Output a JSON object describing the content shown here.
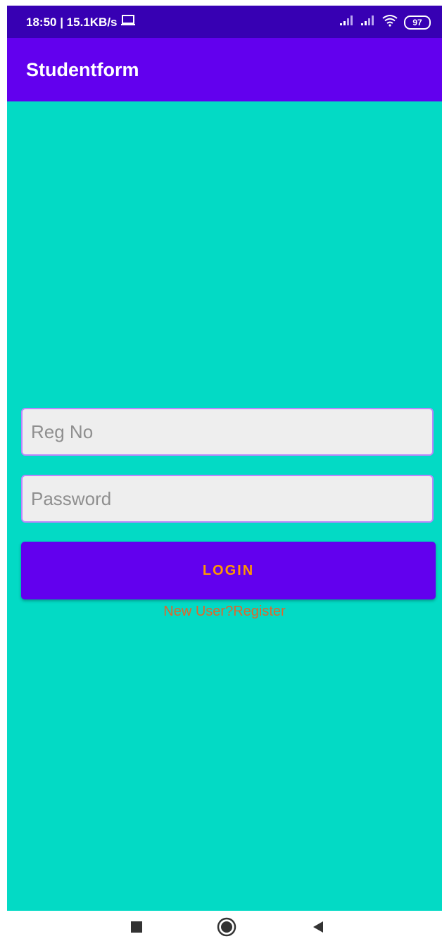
{
  "status_bar": {
    "time_speed": "18:50 | 15.1KB/s",
    "battery": "97",
    "icons": [
      "laptop-icon",
      "signal-icon",
      "signal-icon",
      "wifi-icon",
      "battery-icon"
    ]
  },
  "app_bar": {
    "title": "Studentform"
  },
  "form": {
    "reg_placeholder": "Reg No",
    "password_placeholder": "Password",
    "login_label": "LOGIN",
    "register_link": "New User?Register"
  },
  "nav_bar": {
    "icons": [
      "recents-icon",
      "home-icon",
      "back-icon"
    ]
  },
  "colors": {
    "status_bar": "#3700b3",
    "app_bar": "#6200ee",
    "background": "#03dac5",
    "field_border": "#bb86fc",
    "login_text": "#ff9800",
    "register_text": "#e2652a"
  }
}
